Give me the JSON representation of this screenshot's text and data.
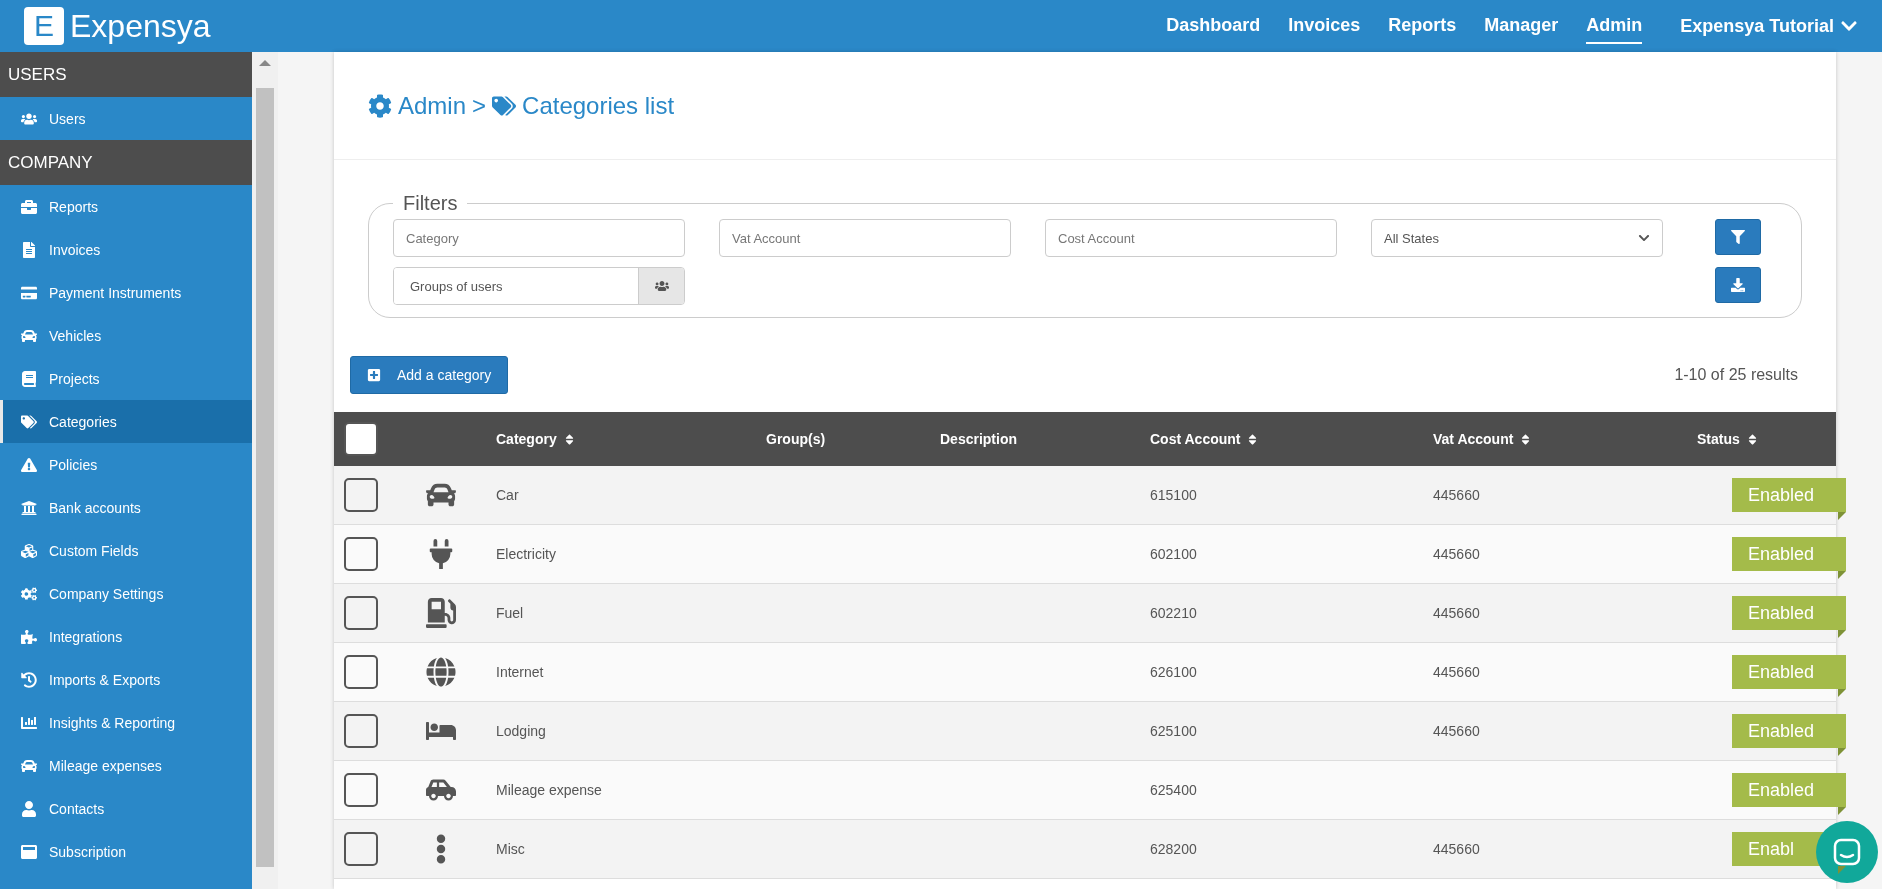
{
  "header": {
    "logo_letter": "E",
    "logo_text": "Expensya",
    "nav": [
      {
        "label": "Dashboard",
        "selected": false
      },
      {
        "label": "Invoices",
        "selected": false
      },
      {
        "label": "Reports",
        "selected": false
      },
      {
        "label": "Manager",
        "selected": false
      },
      {
        "label": "Admin",
        "selected": true
      }
    ],
    "account": "Expensya Tutorial"
  },
  "sidebar": {
    "sections": [
      {
        "title": "USERS",
        "items": [
          {
            "label": "Users",
            "selected": false
          }
        ]
      },
      {
        "title": "COMPANY",
        "items": [
          {
            "label": "Reports",
            "selected": false
          },
          {
            "label": "Invoices",
            "selected": false
          },
          {
            "label": "Payment Instruments",
            "selected": false
          },
          {
            "label": "Vehicles",
            "selected": false
          },
          {
            "label": "Projects",
            "selected": false
          },
          {
            "label": "Categories",
            "selected": true
          },
          {
            "label": "Policies",
            "selected": false
          },
          {
            "label": "Bank accounts",
            "selected": false
          },
          {
            "label": "Custom Fields",
            "selected": false
          },
          {
            "label": "Company Settings",
            "selected": false
          },
          {
            "label": "Integrations",
            "selected": false
          },
          {
            "label": "Imports & Exports",
            "selected": false
          },
          {
            "label": "Insights & Reporting",
            "selected": false
          },
          {
            "label": "Mileage expenses",
            "selected": false
          },
          {
            "label": "Contacts",
            "selected": false
          },
          {
            "label": "Subscription",
            "selected": false
          }
        ]
      }
    ]
  },
  "breadcrumb": {
    "parent": "Admin",
    "separator": ">",
    "current": "Categories list"
  },
  "filters": {
    "legend": "Filters",
    "category": {
      "placeholder": "Category"
    },
    "vat_account": {
      "placeholder": "Vat Account"
    },
    "cost_account": {
      "placeholder": "Cost Account"
    },
    "state": {
      "value": "All States"
    },
    "groups": {
      "placeholder": "Groups of users"
    }
  },
  "add_button": "Add a category",
  "results": "1-10 of 25 results",
  "table": {
    "select_all": {
      "checked": false
    },
    "columns": [
      {
        "label": "Category",
        "sortable": true
      },
      {
        "label": "Group(s)",
        "sortable": false
      },
      {
        "label": "Description",
        "sortable": false
      },
      {
        "label": "Cost Account",
        "sortable": true
      },
      {
        "label": "Vat Account",
        "sortable": true
      },
      {
        "label": "Status",
        "sortable": true
      }
    ],
    "rows": [
      {
        "checked": false,
        "category": "Car",
        "cost_account": "615100",
        "vat_account": "445660",
        "status": "Enabled"
      },
      {
        "checked": false,
        "category": "Electricity",
        "cost_account": "602100",
        "vat_account": "445660",
        "status": "Enabled"
      },
      {
        "checked": false,
        "category": "Fuel",
        "cost_account": "602210",
        "vat_account": "445660",
        "status": "Enabled"
      },
      {
        "checked": false,
        "category": "Internet",
        "cost_account": "626100",
        "vat_account": "445660",
        "status": "Enabled"
      },
      {
        "checked": false,
        "category": "Lodging",
        "cost_account": "625100",
        "vat_account": "445660",
        "status": "Enabled"
      },
      {
        "checked": false,
        "category": "Mileage expense",
        "cost_account": "625400",
        "status": "Enabled"
      },
      {
        "checked": false,
        "category": "Misc",
        "cost_account": "628200",
        "vat_account": "445660",
        "status": "Enabl"
      }
    ]
  }
}
